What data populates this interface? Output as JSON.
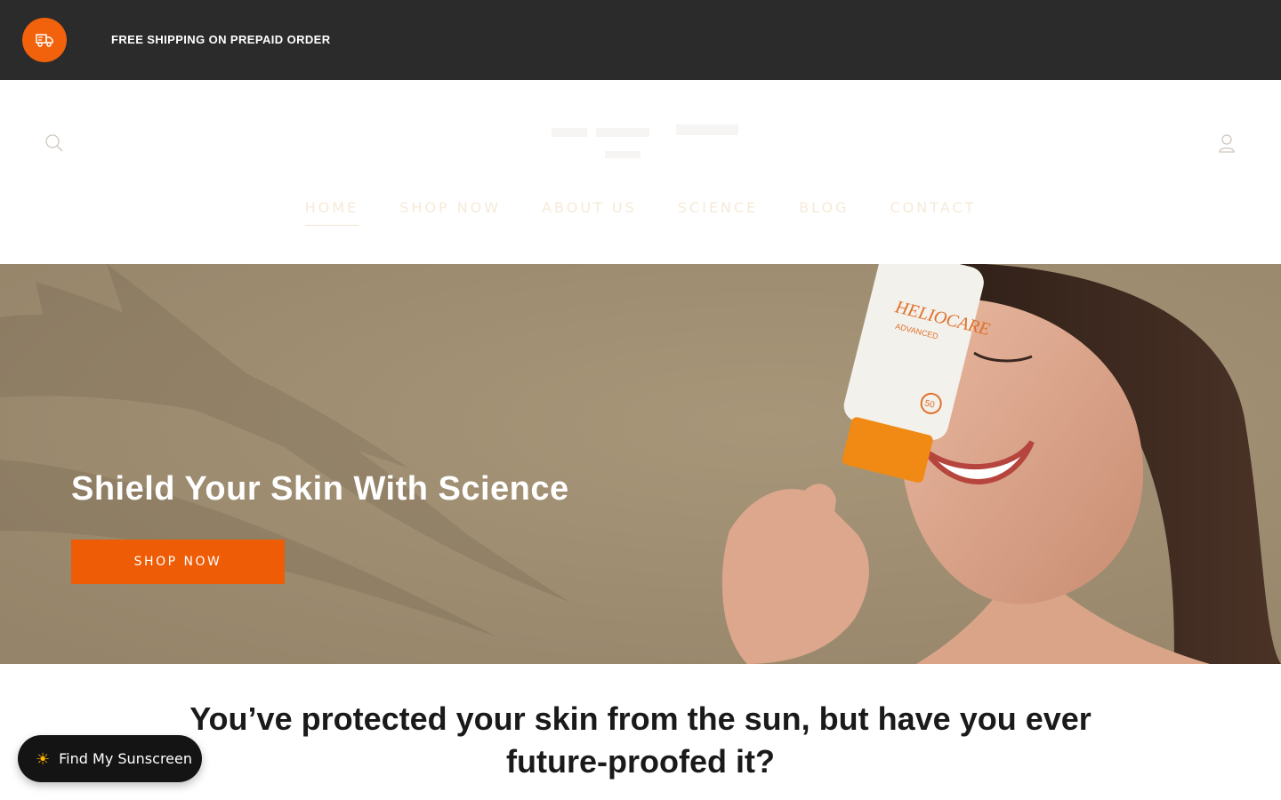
{
  "announcement": {
    "icon": "delivery-truck-icon",
    "text": "FREE SHIPPING ON PREPAID ORDER"
  },
  "header": {
    "search_icon": "search-icon",
    "account_icon": "account-icon",
    "nav": [
      {
        "label": "HOME",
        "active": true
      },
      {
        "label": "SHOP NOW",
        "active": false
      },
      {
        "label": "ABOUT US",
        "active": false
      },
      {
        "label": "SCIENCE",
        "active": false
      },
      {
        "label": "BLOG",
        "active": false
      },
      {
        "label": "CONTACT",
        "active": false
      }
    ]
  },
  "hero": {
    "heading": "Shield Your Skin With Science",
    "cta_label": "SHOP NOW",
    "product_text": {
      "brand": "HELIOCARE",
      "line": "ADVANCED",
      "spf": "50"
    }
  },
  "intro": {
    "heading": "You’ve protected your skin from the sun, but have you ever future-proofed it?"
  },
  "widget": {
    "icon": "sun-icon",
    "label": "Find My Sunscreen"
  },
  "colors": {
    "announcement_bg": "#2b2b2b",
    "accent": "#ee5c05",
    "hero_bg": "#9d8c74",
    "widget_bg": "#141414"
  }
}
